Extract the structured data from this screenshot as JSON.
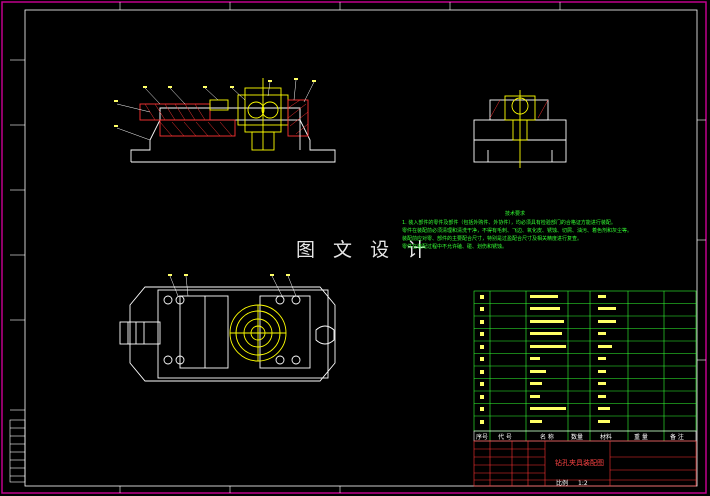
{
  "drawing": {
    "watermark": "图 文 设 计",
    "technical_requirements": {
      "title": "技术要求",
      "lines": [
        "1. 装入部件的零件及部件（包括外购件、外协件），均必须具有检验部门的合格证方能进行装配。",
        "   零件在装配前必须清理和清洗干净，不得有毛刺、飞边、氧化皮、锈蚀、切屑、油污、着色剂和灰尘等。",
        "   装配前应对零、部件的主要配合尺寸，特别是过盈配合尺寸及相关精度进行复查。",
        "   零件在装配过程中不允许磕、碰、划伤和锈蚀。"
      ]
    },
    "bom_header": {
      "index": "序号",
      "code": "代 号",
      "name": "名 称",
      "qty": "数量",
      "material": "材料",
      "weight": "重 量",
      "remark": "备 注"
    },
    "title_block": {
      "drawing_name": "钻孔夹具装配图",
      "scale_label": "比例",
      "scale_value": "1:2"
    }
  }
}
